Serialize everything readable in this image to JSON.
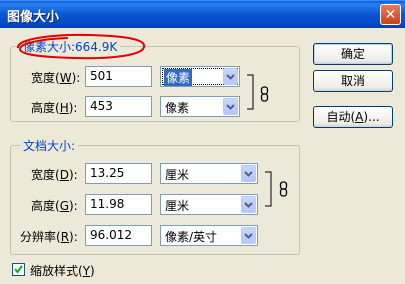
{
  "window": {
    "title": "图像大小",
    "close_glyph": "✕",
    "accent": "#0a56d0"
  },
  "pixel_dimensions": {
    "legend": "像素大小:664.9K",
    "width": {
      "label": "宽度(",
      "key": "W",
      "label_end": "):",
      "value": "501",
      "unit": "像素"
    },
    "height": {
      "label": "高度(",
      "key": "H",
      "label_end": "):",
      "value": "453",
      "unit": "像素"
    }
  },
  "document_size": {
    "legend": "文档大小:",
    "width": {
      "label": "宽度(",
      "key": "D",
      "label_end": "):",
      "value": "13.25",
      "unit": "厘米"
    },
    "height": {
      "label": "高度(",
      "key": "G",
      "label_end": "):",
      "value": "11.98",
      "unit": "厘米"
    },
    "resolution": {
      "label": "分辨率(",
      "key": "R",
      "label_end": "):",
      "value": "96.012",
      "unit": "像素/英寸"
    }
  },
  "buttons": {
    "ok": "确定",
    "cancel": "取消",
    "auto_prefix": "自动(",
    "auto_key": "A",
    "auto_suffix": ")..."
  },
  "options": {
    "scale_styles": {
      "label": "缩放样式(",
      "key": "Y",
      "label_end": ")",
      "checked": true
    }
  },
  "annotation": {
    "color": "#e00000"
  }
}
